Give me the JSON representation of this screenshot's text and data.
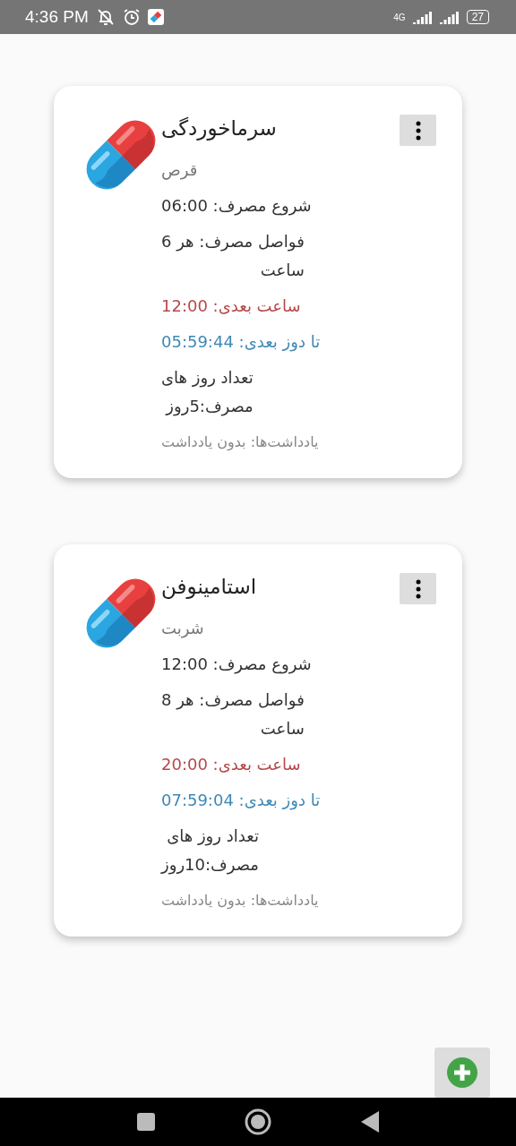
{
  "status_bar": {
    "time": "4:36 PM",
    "network": "4G",
    "battery": "27"
  },
  "medicines": [
    {
      "name": "سرماخوردگی",
      "form": "قرص",
      "start": "شروع مصرف: 06:00",
      "interval": "فواصل مصرف: هر 6\nساعت",
      "next_time": "ساعت بعدی: 12:00",
      "countdown": "تا دوز بعدی: 05:59:44",
      "days": "تعداد روز های\nمصرف:5روز",
      "notes": "یادداشت‌ها: بدون یادداشت"
    },
    {
      "name": "استامینوفن",
      "form": "شربت",
      "start": "شروع مصرف: 12:00",
      "interval": "فواصل مصرف: هر 8\nساعت",
      "next_time": "ساعت بعدی: 20:00",
      "countdown": "تا دوز بعدی: 07:59:04",
      "days": "تعداد روز های\nمصرف:10روز",
      "notes": "یادداشت‌ها: بدون یادداشت"
    }
  ]
}
